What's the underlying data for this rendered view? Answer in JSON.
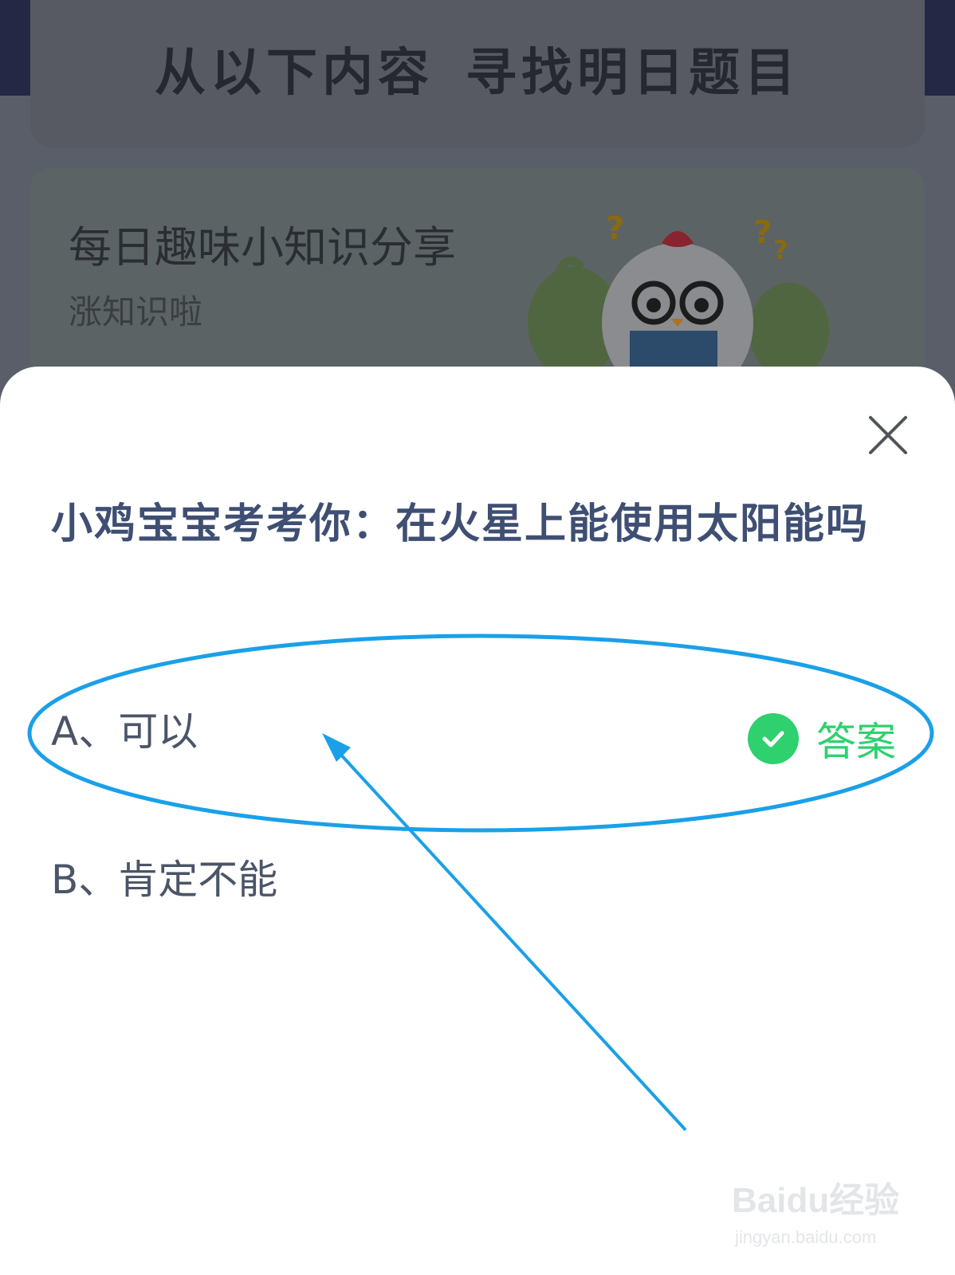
{
  "background": {
    "banner_title_part1": "从以下内容",
    "banner_title_part2": "寻找明日题目",
    "card_title": "每日趣味小知识分享",
    "card_subtitle": "涨知识啦",
    "card_mascot": "chicken-reading-mascot"
  },
  "sheet": {
    "close_icon": "close-icon",
    "question": "小鸡宝宝考考你：在火星上能使用太阳能吗",
    "options": [
      {
        "label": "A、可以",
        "is_answer": true
      },
      {
        "label": "B、肯定不能",
        "is_answer": false
      }
    ],
    "answer_label": "答案",
    "answer_icon": "check-circle-icon"
  },
  "watermark": {
    "brand": "Baidu经验",
    "url": "jingyan.baidu.com"
  },
  "colors": {
    "question_text": "#3f4f73",
    "option_text": "#4b5567",
    "answer_green": "#2fd06e",
    "annotation_blue": "#1aa0e8",
    "overlay_dim": "#3a3e49"
  }
}
